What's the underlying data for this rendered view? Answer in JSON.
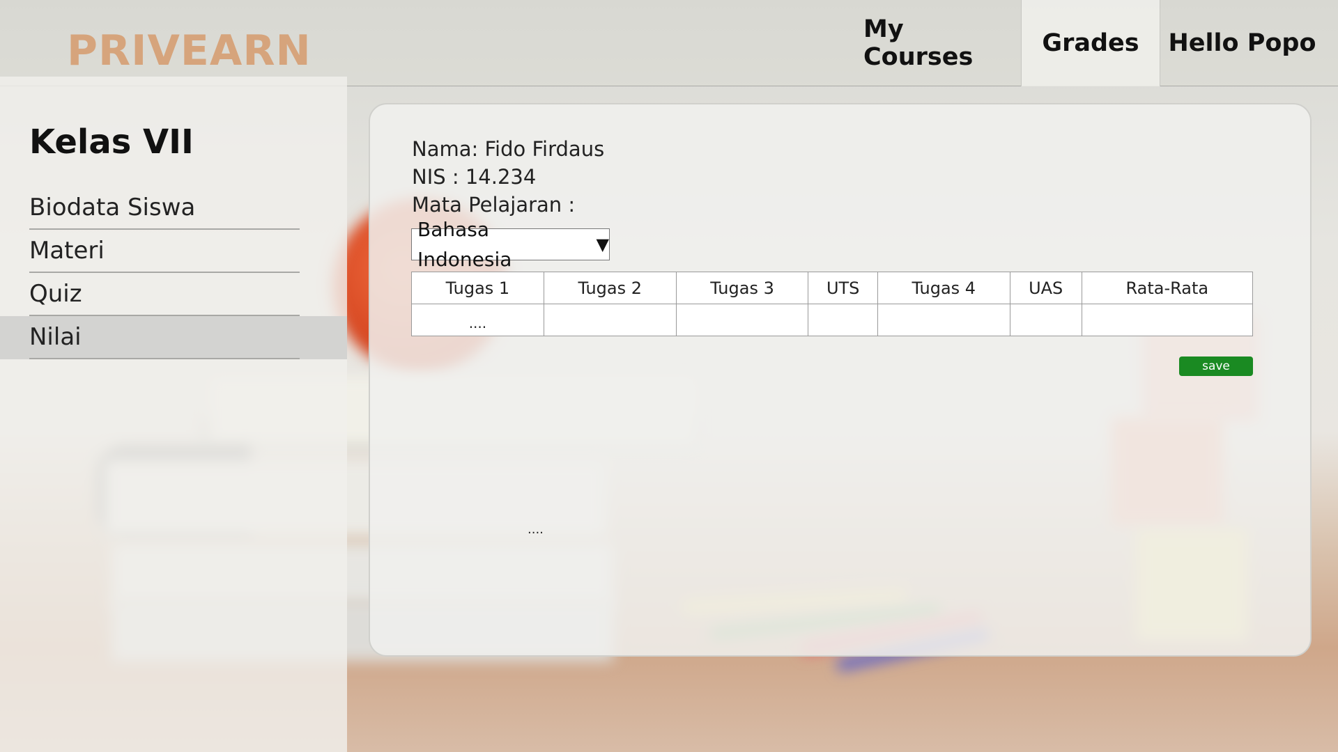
{
  "brand": {
    "logo": "PRIVEARN"
  },
  "nav": {
    "my_courses": "My Courses",
    "grades": "Grades",
    "user": "Hello Popo"
  },
  "sidebar": {
    "title": "Kelas VII",
    "items": [
      {
        "label": "Biodata Siswa",
        "active": false
      },
      {
        "label": "Materi",
        "active": false
      },
      {
        "label": "Quiz",
        "active": false
      },
      {
        "label": "Nilai",
        "active": true
      }
    ]
  },
  "student": {
    "name_line": "Nama: Fido Firdaus",
    "nis_line": "NIS : 14.234",
    "subject_label": "Mata Pelajaran :"
  },
  "subject_select": {
    "value": "Bahasa Indonesia",
    "caret": "▼"
  },
  "grades_table": {
    "columns": [
      "Tugas 1",
      "Tugas 2",
      "Tugas 3",
      "UTS",
      "Tugas 4",
      "UAS",
      "Rata-Rata"
    ],
    "row": [
      "....",
      "",
      "",
      "",
      "",
      "",
      ""
    ]
  },
  "save_button": {
    "label": "save"
  },
  "placeholder_text": "....",
  "colors": {
    "logo": "#d6a47c",
    "save": "#1a8a22",
    "active_item": "#d3d3d1"
  }
}
